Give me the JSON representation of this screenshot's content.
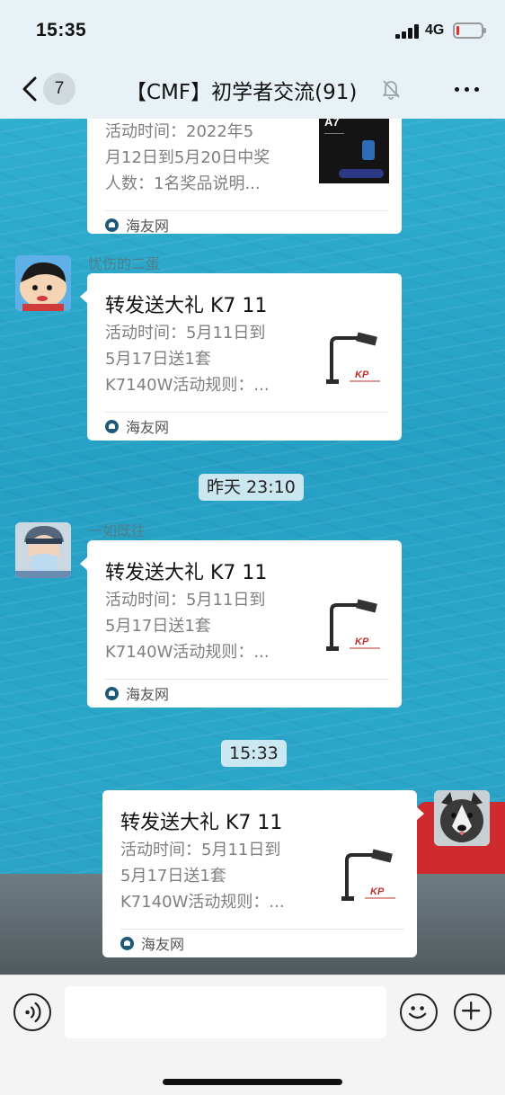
{
  "status_bar": {
    "time": "15:35",
    "network": "4G",
    "battery_level": 0.08
  },
  "nav": {
    "back_count": "7",
    "title": "【CMF】初学者交流(91)",
    "icons": [
      "chevron-left-icon",
      "bell-slash-icon",
      "more-icon"
    ]
  },
  "messages": {
    "m1": {
      "desc_lines": [
        "活动时间：2022年5",
        "月12日到5月20日中奖",
        "人数：1名奖品说明..."
      ],
      "source": "海友网",
      "thumb_text": "A7"
    },
    "m2": {
      "sender": "忧伤的二蛋",
      "title": "转发送大礼 K7 11",
      "desc_lines": [
        "活动时间：5月11日到",
        "5月17日送1套",
        "K7140W活动规则：..."
      ],
      "source": "海友网"
    },
    "ts1": "昨天 23:10",
    "m3": {
      "sender": "一如既往",
      "title": "转发送大礼 K7 11",
      "desc_lines": [
        "活动时间：5月11日到",
        "5月17日送1套",
        "K7140W活动规则：..."
      ],
      "source": "海友网"
    },
    "ts2": "15:33",
    "m4": {
      "title": "转发送大礼 K7 11",
      "desc_lines": [
        "活动时间：5月11日到",
        "5月17日送1套",
        "K7140W活动规则：..."
      ],
      "source": "海友网"
    }
  },
  "input_bar": {
    "placeholder": "",
    "icons": [
      "voice-icon",
      "emoji-icon",
      "plus-icon"
    ]
  },
  "colors": {
    "wallpaper": "#2aa5c6",
    "bar_bg": "#e8f1f5",
    "card_bg": "#ffffff",
    "battery_low": "#e0322b"
  }
}
